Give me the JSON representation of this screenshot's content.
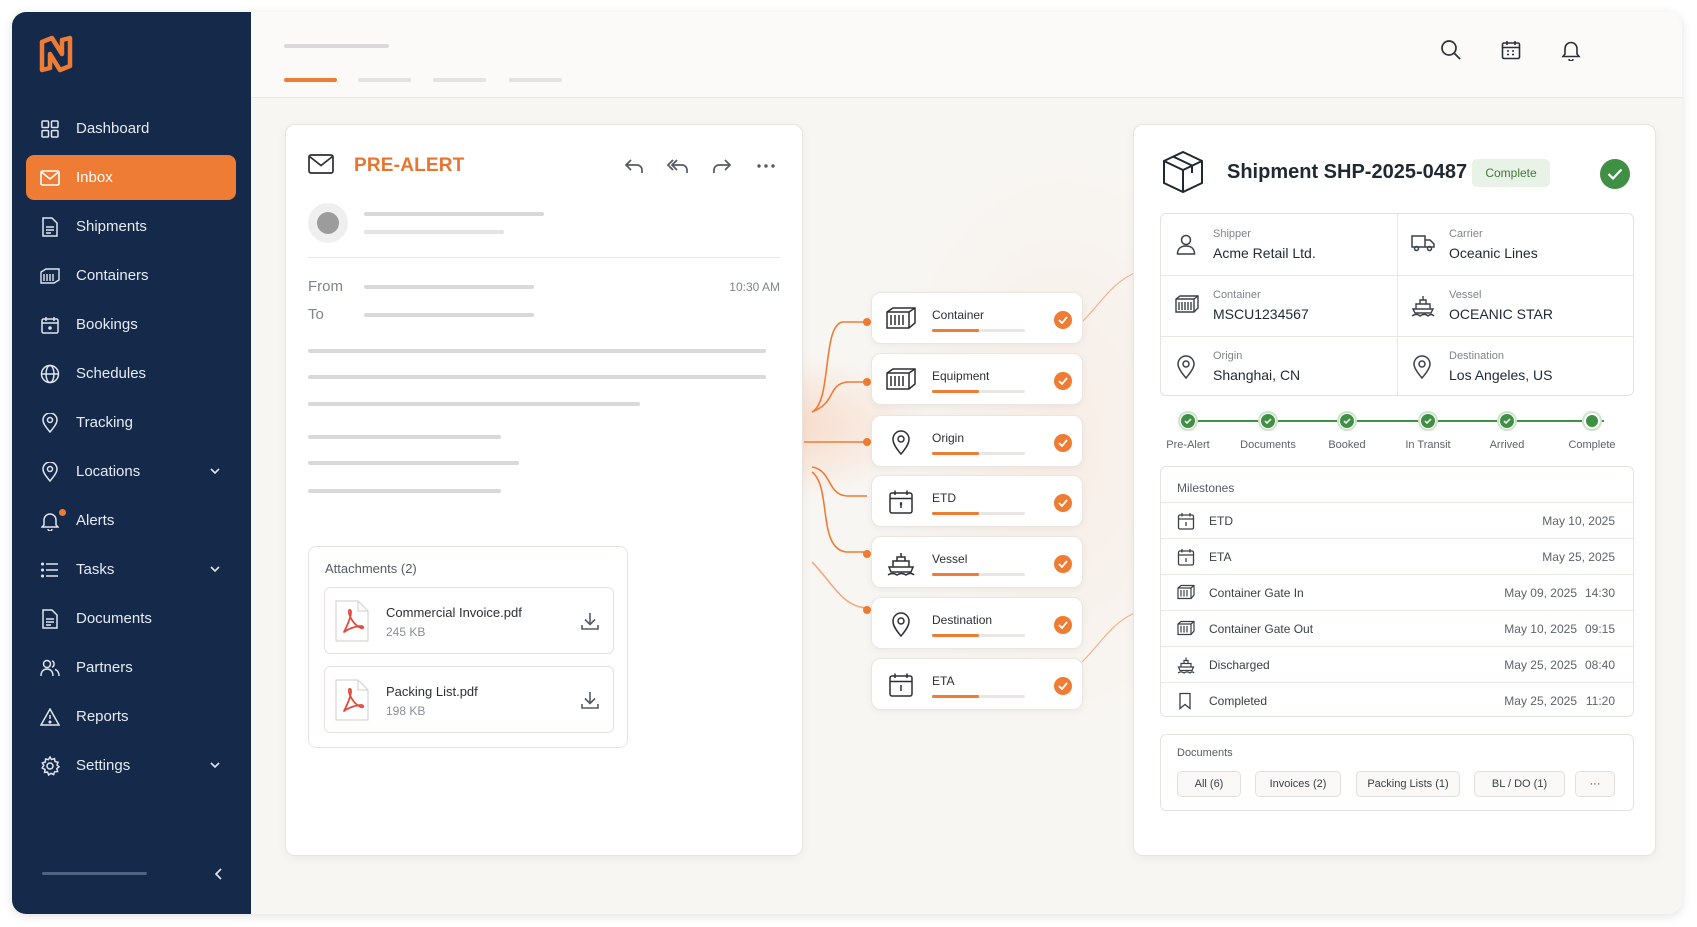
{
  "sidebar": {
    "items": [
      {
        "label": "Dashboard",
        "icon": "grid-icon"
      },
      {
        "label": "Inbox",
        "icon": "mail-icon",
        "active": true
      },
      {
        "label": "Shipments",
        "icon": "document-icon"
      },
      {
        "label": "Containers",
        "icon": "container-icon"
      },
      {
        "label": "Bookings",
        "icon": "calendar-icon"
      },
      {
        "label": "Schedules",
        "icon": "globe-icon"
      },
      {
        "label": "Tracking",
        "icon": "pin-icon"
      },
      {
        "label": "Locations",
        "icon": "location-icon",
        "expandable": true
      },
      {
        "label": "Alerts",
        "icon": "bell-icon",
        "has_dot": true
      },
      {
        "label": "Tasks",
        "icon": "list-icon",
        "expandable": true
      },
      {
        "label": "Documents",
        "icon": "file-icon"
      },
      {
        "label": "Partners",
        "icon": "users-icon"
      },
      {
        "label": "Reports",
        "icon": "warning-icon"
      },
      {
        "label": "Settings",
        "icon": "gear-icon",
        "expandable": true
      }
    ]
  },
  "header": {
    "avatar_initial": "N",
    "icons": [
      "search-icon",
      "calendar-icon",
      "bell-icon"
    ]
  },
  "email": {
    "title": "PRE-ALERT",
    "from_label": "From",
    "to_label": "To",
    "time": "10:30 AM",
    "attachments_title": "Attachments (2)",
    "attachments": [
      {
        "name": "Commercial Invoice.pdf",
        "size": "245 KB"
      },
      {
        "name": "Packing List.pdf",
        "size": "198 KB"
      }
    ]
  },
  "extraction": {
    "fields": [
      {
        "label": "Container",
        "icon": "container-icon"
      },
      {
        "label": "Equipment",
        "icon": "container-icon"
      },
      {
        "label": "Origin",
        "icon": "pin-icon"
      },
      {
        "label": "ETD",
        "icon": "calendar-icon"
      },
      {
        "label": "Vessel",
        "icon": "ship-icon"
      },
      {
        "label": "Destination",
        "icon": "pin-icon"
      },
      {
        "label": "ETA",
        "icon": "calendar-icon"
      }
    ]
  },
  "shipment": {
    "title": "Shipment SHP-2025-0487",
    "status": "Complete",
    "colors": {
      "accent": "#ee7c34",
      "success": "#3f8f45",
      "navy": "#15294a"
    },
    "details": [
      {
        "label": "Shipper",
        "value": "Acme Retail Ltd.",
        "icon": "user-icon"
      },
      {
        "label": "Carrier",
        "value": "Oceanic Lines",
        "icon": "truck-icon"
      },
      {
        "label": "Container",
        "value": "MSCU1234567",
        "icon": "container-icon"
      },
      {
        "label": "Vessel",
        "value": "OCEANIC STAR",
        "icon": "ship-icon"
      },
      {
        "label": "Origin",
        "value": "Shanghai, CN",
        "icon": "pin-icon"
      },
      {
        "label": "Destination",
        "value": "Los Angeles, US",
        "icon": "pin-icon"
      }
    ],
    "progress_steps": [
      "Pre-Alert",
      "Documents",
      "Booked",
      "In Transit",
      "Arrived",
      "Complete"
    ],
    "milestones_title": "Milestones",
    "milestones": [
      {
        "name": "ETD",
        "date": "May 10, 2025",
        "time": "",
        "icon": "calendar-icon"
      },
      {
        "name": "ETA",
        "date": "May 25, 2025",
        "time": "",
        "icon": "calendar-icon"
      },
      {
        "name": "Container Gate In",
        "date": "May 09, 2025",
        "time": "14:30",
        "icon": "container-icon"
      },
      {
        "name": "Container Gate Out",
        "date": "May 10, 2025",
        "time": "09:15",
        "icon": "container-icon"
      },
      {
        "name": "Discharged",
        "date": "May 25, 2025",
        "time": "08:40",
        "icon": "ship-icon"
      },
      {
        "name": "Completed",
        "date": "May 25, 2025",
        "time": "11:20",
        "icon": "bookmark-icon"
      }
    ],
    "documents_title": "Documents",
    "document_filters": [
      "All (6)",
      "Invoices (2)",
      "Packing Lists (1)",
      "BL / DO (1)",
      "···"
    ]
  }
}
